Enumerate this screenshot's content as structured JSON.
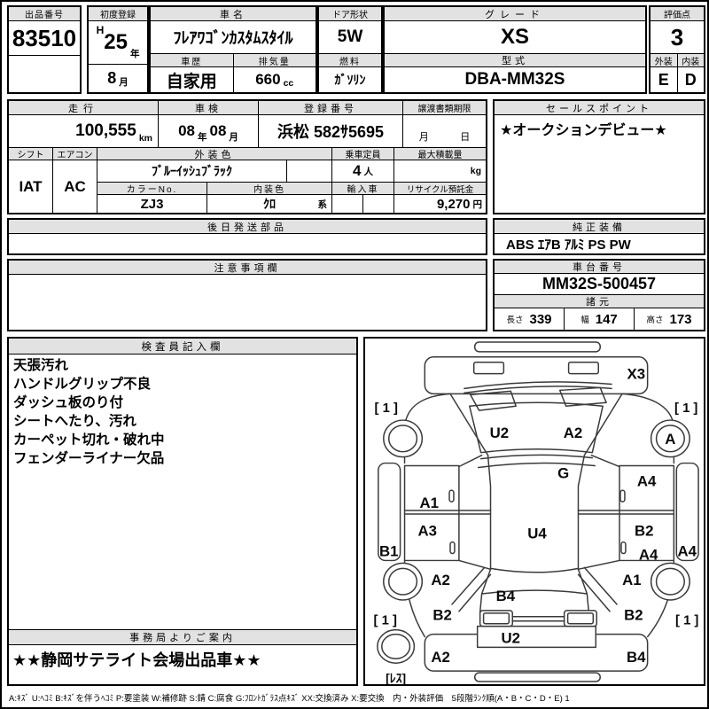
{
  "s1": {
    "lot_label": "出品番号",
    "lot": "83510",
    "firstreg_label": "初度登録",
    "era": "H",
    "year": "25",
    "year_u": "年",
    "month": "8",
    "month_u": "月",
    "name_label": "車名",
    "name": "ﾌﾚｱﾜｺﾞﾝｶｽﾀﾑｽﾀｲﾙ",
    "door_label": "ドア形状",
    "door": "5W",
    "grade_label": "グレード",
    "grade": "XS",
    "score_label": "評価点",
    "score": "3",
    "history_label": "車歴",
    "history": "自家用",
    "disp_label": "排気量",
    "disp": "660",
    "disp_u": "cc",
    "fuel_label": "燃料",
    "fuel": "ｶﾞｿﾘﾝ",
    "model_label": "型式",
    "model": "DBA-MM32S",
    "ext_label": "外装",
    "ext": "E",
    "int_label": "内装",
    "int": "D"
  },
  "s2": {
    "mileage_label": "走行",
    "mileage": "100,555",
    "mileage_u": "km",
    "shaken_label": "車検",
    "shaken1": "08",
    "shaken_y": "年",
    "shaken2": "08",
    "shaken_m": "月",
    "regno_label": "登録番号",
    "regno": "浜松 582ｻ5695",
    "transfer_label": "譲渡書類期限",
    "transfer_m": "月",
    "transfer_d": "日",
    "sales_label": "セールスポイント",
    "sales": "★オークションデビュー★"
  },
  "s3": {
    "shift_label": "シフト",
    "shift": "IAT",
    "ac_label": "エアコン",
    "ac": "AC",
    "extcolor_label": "外装色",
    "extcolor": "ﾌﾞﾙｰｲｯｼｭﾌﾞﾗｯｸ",
    "cap_label": "乗車定員",
    "cap": "4",
    "cap_u": "人",
    "load_label": "最大積載量",
    "load_u": "kg",
    "colorno_label": "カラーNo.",
    "colorno": "ZJ3",
    "intcolor_label": "内装色",
    "intcolor": "ｸﾛ",
    "intcolor_u": "系",
    "import_label": "輸入車",
    "recycle_label": "リサイクル預託金",
    "recycle": "9,270",
    "recycle_u": "円"
  },
  "s4": {
    "parts_label": "後日発送部品",
    "equip_label": "純正装備",
    "equip": "ABS ｴｱB ｱﾙﾐ PS PW"
  },
  "s5": {
    "notes_label": "注意事項欄",
    "chassis_label": "車台番号",
    "chassis": "MM32S-500457",
    "dims_label": "諸元",
    "len_label": "長さ",
    "len": "339",
    "wid_label": "幅",
    "wid": "147",
    "hei_label": "高さ",
    "hei": "173"
  },
  "s6": {
    "inspector_label": "検査員記入欄",
    "lines": [
      "天張汚れ",
      "ハンドルグリップ不良",
      "ダッシュ板のり付",
      "シートへたり、汚れ",
      "カーペット切れ・破れ中",
      "フェンダーライナー欠品"
    ],
    "office_label": "事務局よりご案内",
    "office": "★★静岡サテライト会場出品車★★"
  },
  "legend": "A:ｷｽﾞ U:ﾍｺﾐ B:ｷｽﾞを伴うﾍｺﾐ P:要塗装 W:補修跡 S:錆 C:腐食 G:ﾌﾛﾝﾄｶﾞﾗｽ点ｷｽﾞ XX:交換済み X:要交換　内・外装評価　5段階ﾗﾝｸ順(A・B・C・D・E) 1",
  "diagram": {
    "front_x3": "X3",
    "tire_fl": "[ 1 ]",
    "tire_fr": "[ 1 ]",
    "tire_rl": "[ 1 ]",
    "tire_rr": "[ 1 ]",
    "hood_u2": "U2",
    "hood_a2": "A2",
    "cowl_g": "G",
    "wheel_a": "A",
    "door_fl_a1": "A1",
    "door_rl_a3": "A3",
    "sill_l_b1": "B1",
    "door_fr_a4": "A4",
    "door_rr_b2": "B2",
    "door_rr_a4": "A4",
    "sill_r_a4": "A4",
    "roof_u4": "U4",
    "fender_rl_a2": "A2",
    "fender_rr_a1": "A1",
    "quarter_l_b2": "B2",
    "quarter_r_b2": "B2",
    "rear_window_b4": "B4",
    "gate_u2": "U2",
    "bumper_l_a2": "A2",
    "bumper_r_b4": "B4",
    "spare": "[ﾚｽ]"
  }
}
